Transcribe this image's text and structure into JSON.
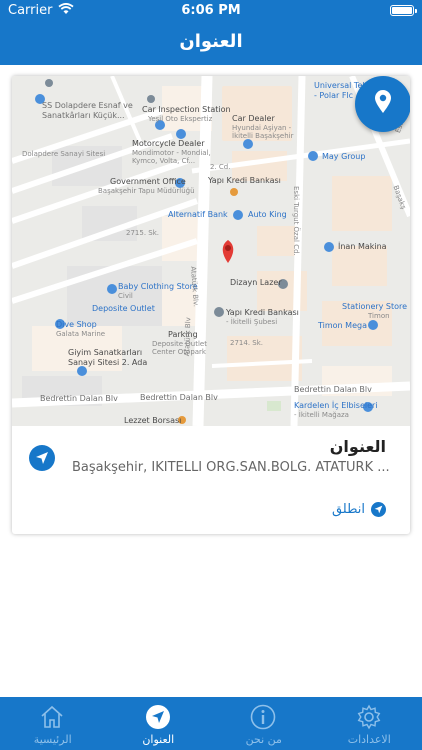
{
  "status_bar": {
    "carrier": "Carrier",
    "time": "6:06 PM"
  },
  "nav": {
    "title": "العنوان"
  },
  "map": {
    "labels": {
      "universal": "Universal Tekn",
      "polar": "- Polar Flc",
      "car_inspection": "Car Inspection Station",
      "yesil_oto": "Yeşil Oto Ekspertiz",
      "car_dealer": "Car Dealer",
      "hyundai": "Hyundai Aşiyan -",
      "hyundai2": "İkitelli Başakşehir",
      "ss_dolapdere": "SS Dolapdere Esnaf ve",
      "sanatkarlari": "Sanatkârları Küçük...",
      "dolapdere_sanayi": "Dolapdere Sanayi Sitesi",
      "motorcycle": "Motorcycle Dealer",
      "mondimotor": "Mondimotor - Mondial,",
      "kymco": "Kymco, Volta, Cf...",
      "may_group": "May Group",
      "cd_2": "2. Cd.",
      "gov_office": "Government Office",
      "basaksehir_tapu": "Başakşehir Tapu Müdürlüğü",
      "yapi_kredi_1": "Yapı Kredi Bankası",
      "alternatif": "Alternatif Bank",
      "auto_king": "Auto King",
      "sk_2715": "2715. Sk.",
      "inan": "İnan Makina",
      "baby_clothing": "Baby Clothing Store",
      "civil": "Civil",
      "deposite": "Deposite Outlet",
      "dizayn": "Dizayn Lazer",
      "stationery": "Stationery Store",
      "timon_small": "Timon",
      "timon_mega": "Timon Mega",
      "dive_shop": "Dive Shop",
      "galata": "Galata Marine",
      "parking": "Parking",
      "deposite_center": "Deposite Outlet",
      "center_otopark": "Center Otopark",
      "yapi_kredi_2": "Yapı Kredi Bankası",
      "ikitelli_subesi": "- İkitelli Şubesi",
      "sk_2714": "2714. Sk.",
      "giyim": "Giyim Sanatkarları",
      "sanayi_sitesi": "Sanayi Sitesi 2. Ada",
      "bedrettin_1": "Bedrettin Dalan Blv",
      "bedrettin_2": "Bedrettin Dalan Blv",
      "bedrettin_3": "Bedrettin Dalan Blv",
      "kardelen": "Kardelen İç Elbiseleri",
      "kardelen2": "- İkitelli Mağaza",
      "lezzet": "Lezzet Borsası",
      "ataturk_blv": "Atatürk Blv",
      "ataturk_blv_2": "Atatürk Blv.",
      "eski_turgut": "Eski Turgut Özal Cd.",
      "basak": "Başakş",
      "eski_yolu": "Eski Yolu"
    }
  },
  "card": {
    "title": "العنوان",
    "address": "Başakşehir, İKİTELLİ ORG.SAN.BÖLG. ATATÜRK BULVARI",
    "start_label": "انطلق"
  },
  "tabs": [
    {
      "label": "الرئيسية",
      "icon": "home-icon"
    },
    {
      "label": "العنوان",
      "icon": "navigation-icon"
    },
    {
      "label": "من نحن",
      "icon": "info-icon"
    },
    {
      "label": "الاعدادات",
      "icon": "gear-icon"
    }
  ],
  "colors": {
    "primary": "#1777c9",
    "map_pin": "#e33b35",
    "inactive_tab": "#8ec0ea"
  }
}
